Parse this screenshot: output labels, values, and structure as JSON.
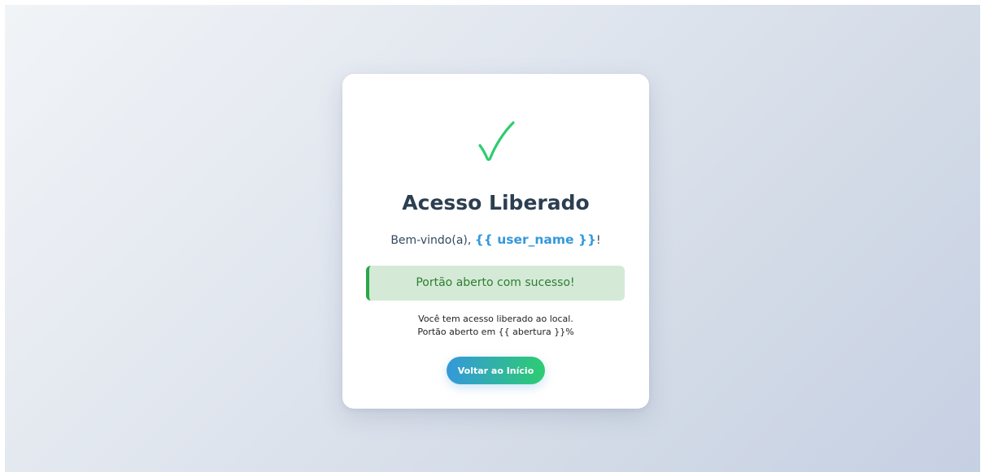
{
  "card": {
    "icon": "check-mark-icon",
    "title": "Acesso Liberado",
    "welcome_prefix": "Bem-vindo(a),",
    "user_name": "{{ user_name }}",
    "welcome_suffix": "!",
    "alert_message": "Portão aberto com sucesso!",
    "info_line_1": "Você tem acesso liberado ao local.",
    "info_line_2": "Portão aberto em {{ abertura }}%",
    "back_button_label": "Voltar ao Início"
  },
  "colors": {
    "title": "#2c3e50",
    "accent_blue": "#3498db",
    "success_green": "#2ecc71",
    "alert_bg": "#d4ead6",
    "alert_border": "#28a745",
    "alert_text": "#2e7d32"
  }
}
